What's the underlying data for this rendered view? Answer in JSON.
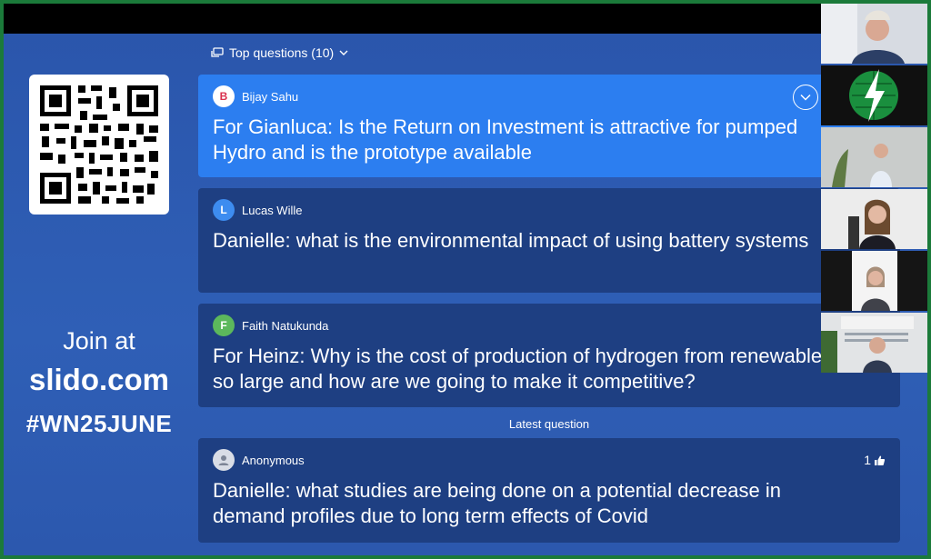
{
  "sidebar": {
    "join_line": "Join at",
    "site": "slido.com",
    "event_code": "#WN25JUNE"
  },
  "header": {
    "top_questions": "Top questions (10)"
  },
  "questions": [
    {
      "initial": "B",
      "author": "Bijay Sahu",
      "avatar_color": "#ffffff",
      "initial_color": "#d9314e",
      "line1": "For Gianluca: Is the Return on Investment is attractive for pumped",
      "line2": "Hydro and is the prototype available"
    },
    {
      "initial": "L",
      "author": "Lucas Wille",
      "avatar_color": "#3d8cf0",
      "initial_color": "#ffffff",
      "line1": "Danielle: what is the environmental impact of using battery systems",
      "line2": ""
    },
    {
      "initial": "F",
      "author": "Faith Natukunda",
      "avatar_color": "#5cb85c",
      "initial_color": "#ffffff",
      "line1": "For Heinz: Why is the cost of production of hydrogen from renewables",
      "line2": "so large and how are we going to make it competitive?"
    }
  ],
  "latest": {
    "label": "Latest question",
    "author": "Anonymous",
    "likes": "1",
    "line1": "Danielle: what studies are being done on a potential decrease in",
    "line2": "demand profiles due to long term effects of Covid"
  },
  "colors": {
    "background": "#2e5cb0",
    "card": "#1e3f82",
    "highlight_card": "#2c7ef0",
    "frame_border": "#1b7a3a"
  }
}
